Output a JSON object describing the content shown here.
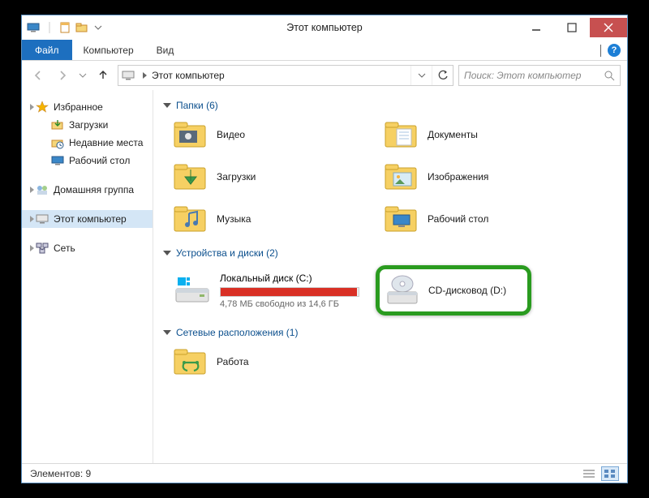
{
  "title": "Этот компьютер",
  "ribbon": {
    "file": "Файл",
    "tabs": [
      "Компьютер",
      "Вид"
    ]
  },
  "address": {
    "path": "Этот компьютер"
  },
  "search": {
    "placeholder": "Поиск: Этот компьютер"
  },
  "sidebar": {
    "favorites": {
      "label": "Избранное",
      "items": [
        {
          "label": "Загрузки"
        },
        {
          "label": "Недавние места"
        },
        {
          "label": "Рабочий стол"
        }
      ]
    },
    "homegroup": {
      "label": "Домашняя группа"
    },
    "thispc": {
      "label": "Этот компьютер"
    },
    "network": {
      "label": "Сеть"
    }
  },
  "sections": {
    "folders": {
      "title": "Папки (6)",
      "items": [
        {
          "label": "Видео"
        },
        {
          "label": "Документы"
        },
        {
          "label": "Загрузки"
        },
        {
          "label": "Изображения"
        },
        {
          "label": "Музыка"
        },
        {
          "label": "Рабочий стол"
        }
      ]
    },
    "devices": {
      "title": "Устройства и диски (2)",
      "drive": {
        "name": "Локальный диск (C:)",
        "sub": "4,78 МБ свободно из 14,6 ГБ",
        "fill_pct": 99
      },
      "cd": {
        "name": "CD-дисковод (D:)"
      }
    },
    "network": {
      "title": "Сетевые расположения (1)",
      "item": {
        "label": "Работа"
      }
    }
  },
  "status": {
    "text": "Элементов: 9"
  }
}
